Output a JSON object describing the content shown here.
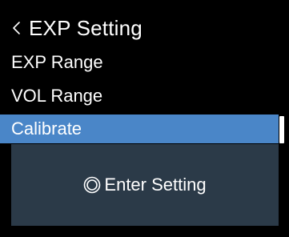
{
  "header": {
    "back_glyph": "<",
    "title": "EXP Setting"
  },
  "menu": {
    "items": [
      {
        "label": "EXP Range",
        "selected": false
      },
      {
        "label": "VOL Range",
        "selected": false
      },
      {
        "label": "Calibrate",
        "selected": true
      }
    ]
  },
  "panel": {
    "enter_label": "Enter Setting",
    "enter_icon": "double-circle-icon"
  },
  "colors": {
    "background": "#000000",
    "selected_item": "#4a86c8",
    "panel": "#2b3a48",
    "text": "#ffffff"
  }
}
